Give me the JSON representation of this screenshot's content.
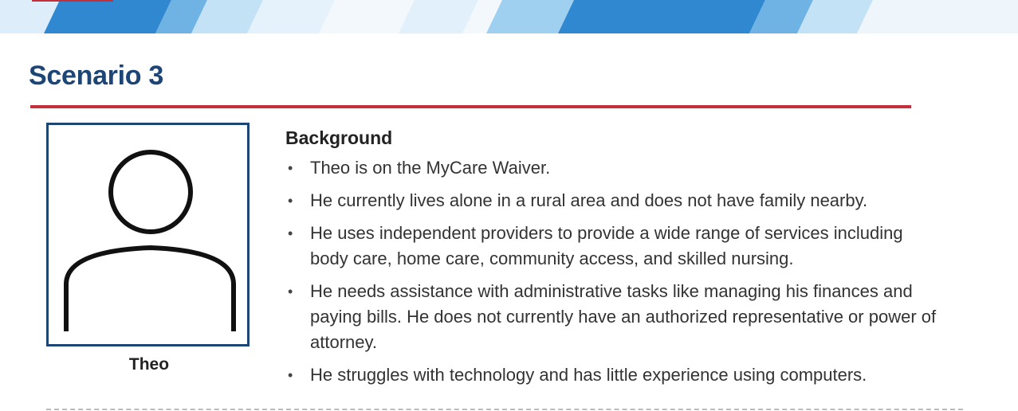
{
  "page": {
    "title": "Scenario 3"
  },
  "colors": {
    "title": "#1d4677",
    "rule": "#c32f3a",
    "banner_dark": "#2f88d0",
    "banner_mid": "#6fb3e5",
    "banner_light": "#c4e2f6",
    "accent_red": "#c32f3a"
  },
  "avatar": {
    "icon": "person-icon",
    "name": "Theo"
  },
  "background": {
    "heading": "Background",
    "items": [
      "Theo is on the MyCare Waiver.",
      "He currently lives alone in a rural area and does not have family nearby.",
      "He uses independent providers to provide a wide range of services including body care, home care, community access, and skilled nursing.",
      "He needs assistance with administrative tasks like managing his finances and paying bills. He does not currently have an authorized representative or power of attorney.",
      "He struggles with technology and has little experience using computers."
    ]
  }
}
